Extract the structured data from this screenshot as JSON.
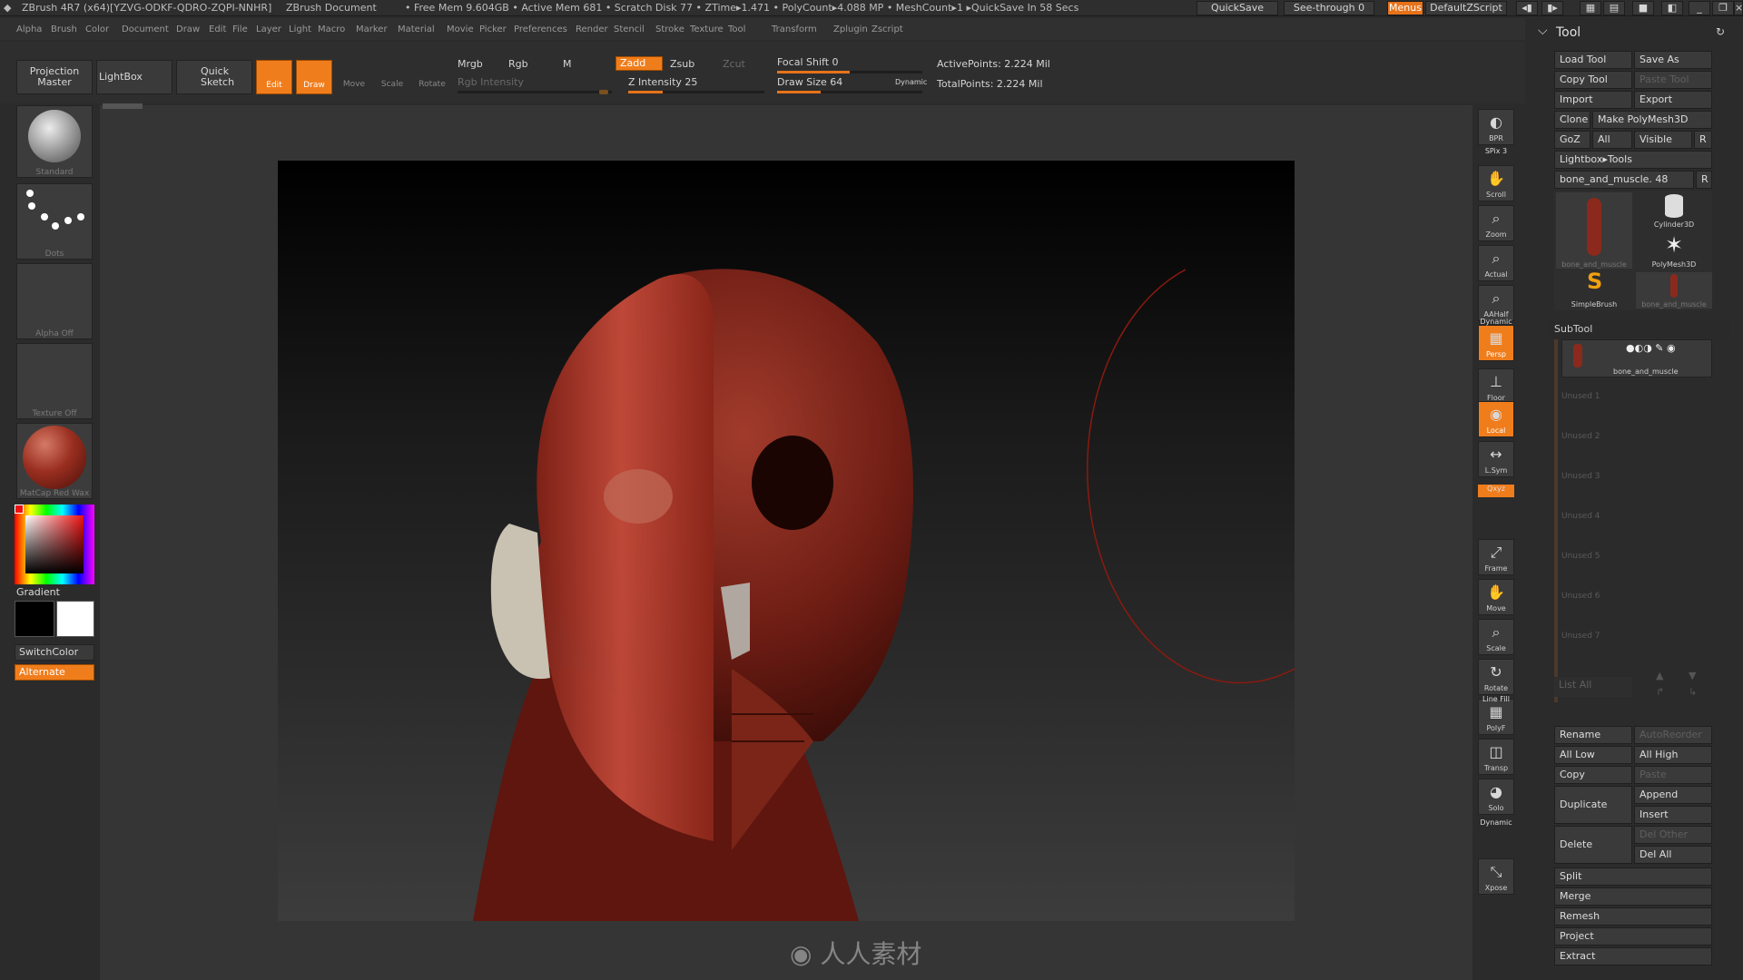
{
  "titlebar": {
    "app": "ZBrush 4R7 (x64)[YZVG-ODKF-QDRO-ZQPI-NNHR]",
    "doc": "ZBrush Document",
    "stats": "• Free Mem 9.604GB • Active Mem 681 • Scratch Disk 77 • ZTime▸1.471 • PolyCount▸4.088 MP • MeshCount▸1 ▸QuickSave In 58 Secs",
    "quicksave": "QuickSave",
    "seethrough": "See-through  0",
    "menus": "Menus",
    "zscript": "DefaultZScript"
  },
  "menu": [
    "Alpha",
    "Brush",
    "Color",
    "Document",
    "Draw",
    "Edit",
    "File",
    "Layer",
    "Light",
    "Macro",
    "Marker",
    "Material",
    "Movie",
    "Picker",
    "Preferences",
    "Render",
    "Stencil",
    "Stroke",
    "Texture",
    "Tool",
    "Transform",
    "Zplugin",
    "Zscript"
  ],
  "toolbar": {
    "projection_master": "Projection Master",
    "lightbox": "LightBox",
    "quick_sketch": "Quick Sketch",
    "edit": "Edit",
    "draw": "Draw",
    "move": "Move",
    "scale": "Scale",
    "rotate": "Rotate",
    "mrgb": "Mrgb",
    "rgb": "Rgb",
    "m": "M",
    "rgb_intensity": "Rgb Intensity",
    "zadd": "Zadd",
    "zsub": "Zsub",
    "zcut": "Zcut",
    "z_intensity": "Z Intensity 25",
    "focal_shift": "Focal Shift 0",
    "draw_size": "Draw Size 64",
    "dynamic": "Dynamic",
    "active_points": "ActivePoints: 2.224 Mil",
    "total_points": "TotalPoints: 2.224 Mil",
    "z_intensity_level": 0.25,
    "focal_shift_level": 0.5,
    "draw_size_level": 0.3
  },
  "left": {
    "brush": "Standard",
    "stroke": "Dots",
    "alpha": "Alpha Off",
    "texture": "Texture Off",
    "material": "MatCap Red Wax",
    "gradient": "Gradient",
    "switchcolor": "SwitchColor",
    "alternate": "Alternate"
  },
  "rightshelf": {
    "bpr": "BPR",
    "spix": "SPix 3",
    "scroll": "Scroll",
    "zoom": "Zoom",
    "actual": "Actual",
    "aahalf": "AAHalf",
    "dynamic": "Dynamic",
    "persp": "Persp",
    "floor": "Floor",
    "local": "Local",
    "lsym": "L.Sym",
    "xyz": "Qxyz",
    "frame": "Frame",
    "move": "Move",
    "scale": "Scale",
    "rotate": "Rotate",
    "linefill": "Line Fill",
    "polyf": "PolyF",
    "transp": "Transp",
    "dynamic2": "Dynamic",
    "solo": "Solo",
    "xpose": "Xpose"
  },
  "tool": {
    "title": "Tool",
    "load": "Load Tool",
    "saveas": "Save As",
    "copy": "Copy Tool",
    "paste": "Paste Tool",
    "import": "Import",
    "export": "Export",
    "clone": "Clone",
    "make": "Make PolyMesh3D",
    "goz": "GoZ",
    "all": "All",
    "visible": "Visible",
    "r": "R",
    "lightbox_tools": "Lightbox▸Tools",
    "current": "bone_and_muscle. 48",
    "thumbs": [
      "bone_and_muscle",
      "Cylinder3D",
      "PolyMesh3D",
      "SimpleBrush",
      "bone_and_muscle"
    ],
    "subtool": "SubTool",
    "subtool_item": "bone_and_muscle",
    "unused": [
      "Unused 1",
      "Unused 2",
      "Unused 3",
      "Unused 4",
      "Unused 5",
      "Unused 6",
      "Unused 7"
    ],
    "list_all": "List All",
    "rename": "Rename",
    "autoreorder": "AutoReorder",
    "all_low": "All Low",
    "all_high": "All High",
    "copy2": "Copy",
    "paste2": "Paste",
    "duplicate": "Duplicate",
    "append": "Append",
    "insert": "Insert",
    "delete": "Delete",
    "del_other": "Del Other",
    "del_all": "Del All",
    "split": "Split",
    "merge": "Merge",
    "remesh": "Remesh",
    "project": "Project",
    "extract": "Extract"
  },
  "watermark": "人人素材"
}
